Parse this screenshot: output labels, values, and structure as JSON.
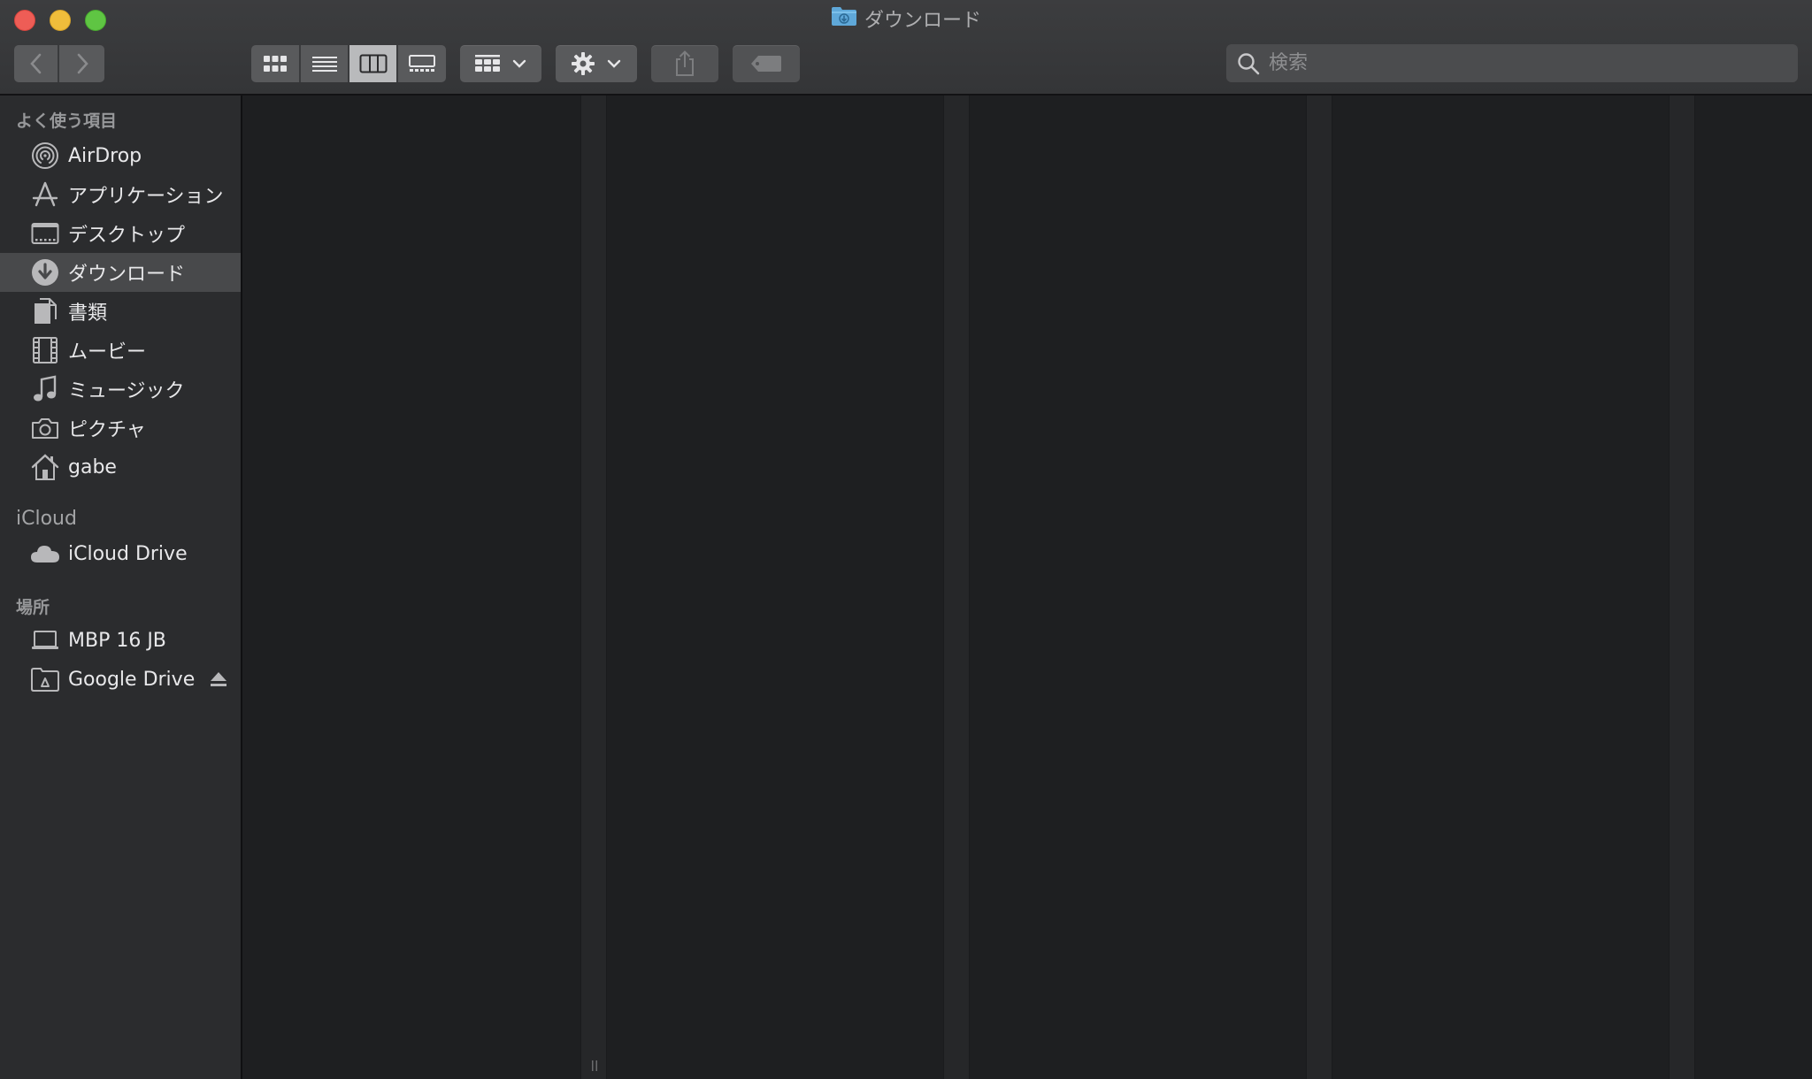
{
  "window": {
    "title": "ダウンロード"
  },
  "toolbar": {
    "back": "back-icon",
    "forward": "forward-icon",
    "view_modes": [
      "icon-view",
      "list-view",
      "column-view",
      "gallery-view"
    ],
    "active_view": "column-view",
    "group": "group-icon",
    "action": "gear-icon",
    "share": "share-icon",
    "tag": "tag-icon"
  },
  "search": {
    "placeholder": "検索",
    "value": ""
  },
  "sidebar": {
    "favorites_header": "よく使う項目",
    "favorites": [
      {
        "label": "AirDrop",
        "icon": "airdrop-icon"
      },
      {
        "label": "アプリケーション",
        "icon": "applications-icon"
      },
      {
        "label": "デスクトップ",
        "icon": "desktop-icon"
      },
      {
        "label": "ダウンロード",
        "icon": "downloads-icon",
        "selected": true
      },
      {
        "label": "書類",
        "icon": "documents-icon"
      },
      {
        "label": "ムービー",
        "icon": "movies-icon"
      },
      {
        "label": "ミュージック",
        "icon": "music-icon"
      },
      {
        "label": "ピクチャ",
        "icon": "pictures-icon"
      },
      {
        "label": "gabe",
        "icon": "home-icon"
      }
    ],
    "icloud_header": "iCloud",
    "icloud": [
      {
        "label": "iCloud Drive",
        "icon": "cloud-icon"
      }
    ],
    "locations_header": "場所",
    "locations": [
      {
        "label": "MBP 16 JB",
        "icon": "laptop-icon"
      },
      {
        "label": "Google Drive",
        "icon": "drive-folder-icon",
        "eject": "eject-icon"
      }
    ]
  },
  "colors": {
    "selection": "#48494b",
    "sidebar_bg": "#2b2c2e",
    "content_bg": "#1e1f21",
    "folder_accent": "#5fa8d9"
  }
}
